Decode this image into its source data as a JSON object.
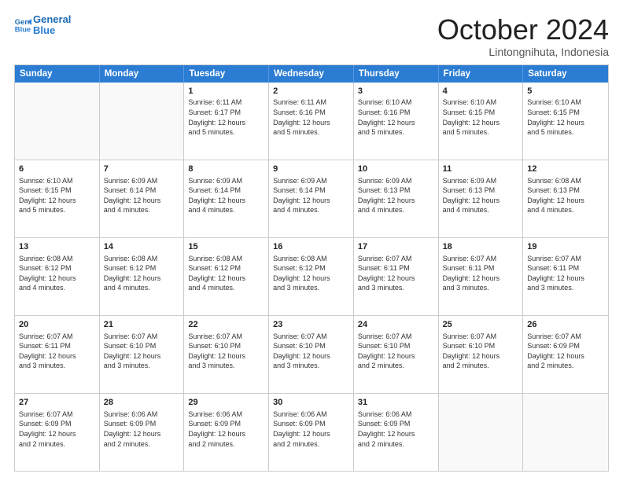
{
  "logo": {
    "line1": "General",
    "line2": "Blue"
  },
  "title": "October 2024",
  "location": "Lintongnihuta, Indonesia",
  "header_days": [
    "Sunday",
    "Monday",
    "Tuesday",
    "Wednesday",
    "Thursday",
    "Friday",
    "Saturday"
  ],
  "rows": [
    [
      {
        "day": "",
        "info": ""
      },
      {
        "day": "",
        "info": ""
      },
      {
        "day": "1",
        "info": "Sunrise: 6:11 AM\nSunset: 6:17 PM\nDaylight: 12 hours\nand 5 minutes."
      },
      {
        "day": "2",
        "info": "Sunrise: 6:11 AM\nSunset: 6:16 PM\nDaylight: 12 hours\nand 5 minutes."
      },
      {
        "day": "3",
        "info": "Sunrise: 6:10 AM\nSunset: 6:16 PM\nDaylight: 12 hours\nand 5 minutes."
      },
      {
        "day": "4",
        "info": "Sunrise: 6:10 AM\nSunset: 6:15 PM\nDaylight: 12 hours\nand 5 minutes."
      },
      {
        "day": "5",
        "info": "Sunrise: 6:10 AM\nSunset: 6:15 PM\nDaylight: 12 hours\nand 5 minutes."
      }
    ],
    [
      {
        "day": "6",
        "info": "Sunrise: 6:10 AM\nSunset: 6:15 PM\nDaylight: 12 hours\nand 5 minutes."
      },
      {
        "day": "7",
        "info": "Sunrise: 6:09 AM\nSunset: 6:14 PM\nDaylight: 12 hours\nand 4 minutes."
      },
      {
        "day": "8",
        "info": "Sunrise: 6:09 AM\nSunset: 6:14 PM\nDaylight: 12 hours\nand 4 minutes."
      },
      {
        "day": "9",
        "info": "Sunrise: 6:09 AM\nSunset: 6:14 PM\nDaylight: 12 hours\nand 4 minutes."
      },
      {
        "day": "10",
        "info": "Sunrise: 6:09 AM\nSunset: 6:13 PM\nDaylight: 12 hours\nand 4 minutes."
      },
      {
        "day": "11",
        "info": "Sunrise: 6:09 AM\nSunset: 6:13 PM\nDaylight: 12 hours\nand 4 minutes."
      },
      {
        "day": "12",
        "info": "Sunrise: 6:08 AM\nSunset: 6:13 PM\nDaylight: 12 hours\nand 4 minutes."
      }
    ],
    [
      {
        "day": "13",
        "info": "Sunrise: 6:08 AM\nSunset: 6:12 PM\nDaylight: 12 hours\nand 4 minutes."
      },
      {
        "day": "14",
        "info": "Sunrise: 6:08 AM\nSunset: 6:12 PM\nDaylight: 12 hours\nand 4 minutes."
      },
      {
        "day": "15",
        "info": "Sunrise: 6:08 AM\nSunset: 6:12 PM\nDaylight: 12 hours\nand 4 minutes."
      },
      {
        "day": "16",
        "info": "Sunrise: 6:08 AM\nSunset: 6:12 PM\nDaylight: 12 hours\nand 3 minutes."
      },
      {
        "day": "17",
        "info": "Sunrise: 6:07 AM\nSunset: 6:11 PM\nDaylight: 12 hours\nand 3 minutes."
      },
      {
        "day": "18",
        "info": "Sunrise: 6:07 AM\nSunset: 6:11 PM\nDaylight: 12 hours\nand 3 minutes."
      },
      {
        "day": "19",
        "info": "Sunrise: 6:07 AM\nSunset: 6:11 PM\nDaylight: 12 hours\nand 3 minutes."
      }
    ],
    [
      {
        "day": "20",
        "info": "Sunrise: 6:07 AM\nSunset: 6:11 PM\nDaylight: 12 hours\nand 3 minutes."
      },
      {
        "day": "21",
        "info": "Sunrise: 6:07 AM\nSunset: 6:10 PM\nDaylight: 12 hours\nand 3 minutes."
      },
      {
        "day": "22",
        "info": "Sunrise: 6:07 AM\nSunset: 6:10 PM\nDaylight: 12 hours\nand 3 minutes."
      },
      {
        "day": "23",
        "info": "Sunrise: 6:07 AM\nSunset: 6:10 PM\nDaylight: 12 hours\nand 3 minutes."
      },
      {
        "day": "24",
        "info": "Sunrise: 6:07 AM\nSunset: 6:10 PM\nDaylight: 12 hours\nand 2 minutes."
      },
      {
        "day": "25",
        "info": "Sunrise: 6:07 AM\nSunset: 6:10 PM\nDaylight: 12 hours\nand 2 minutes."
      },
      {
        "day": "26",
        "info": "Sunrise: 6:07 AM\nSunset: 6:09 PM\nDaylight: 12 hours\nand 2 minutes."
      }
    ],
    [
      {
        "day": "27",
        "info": "Sunrise: 6:07 AM\nSunset: 6:09 PM\nDaylight: 12 hours\nand 2 minutes."
      },
      {
        "day": "28",
        "info": "Sunrise: 6:06 AM\nSunset: 6:09 PM\nDaylight: 12 hours\nand 2 minutes."
      },
      {
        "day": "29",
        "info": "Sunrise: 6:06 AM\nSunset: 6:09 PM\nDaylight: 12 hours\nand 2 minutes."
      },
      {
        "day": "30",
        "info": "Sunrise: 6:06 AM\nSunset: 6:09 PM\nDaylight: 12 hours\nand 2 minutes."
      },
      {
        "day": "31",
        "info": "Sunrise: 6:06 AM\nSunset: 6:09 PM\nDaylight: 12 hours\nand 2 minutes."
      },
      {
        "day": "",
        "info": ""
      },
      {
        "day": "",
        "info": ""
      }
    ]
  ]
}
